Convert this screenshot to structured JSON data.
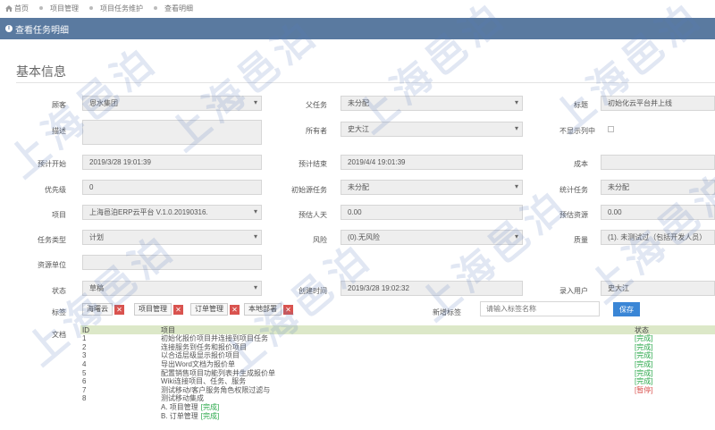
{
  "breadcrumb": [
    "首页",
    "项目管理",
    "项目任务维护",
    "查看明细"
  ],
  "panel_title": "查看任务明细",
  "section_title": "基本信息",
  "fields": {
    "customer": {
      "label": "顾客",
      "value": "恩水集团"
    },
    "parent_task": {
      "label": "父任务",
      "value": "未分配"
    },
    "title": {
      "label": "标题",
      "value": "初始化云平台并上线"
    },
    "description": {
      "label": "描述",
      "value": ""
    },
    "owner": {
      "label": "所有者",
      "value": "史大江"
    },
    "hide_in_list": {
      "label": "不显示列中"
    },
    "plan_start": {
      "label": "预计开始",
      "value": "2019/3/28 19:01:39"
    },
    "plan_end": {
      "label": "预计结束",
      "value": "2019/4/4 19:01:39"
    },
    "cost": {
      "label": "成本",
      "value": ""
    },
    "priority": {
      "label": "优先级",
      "value": "0"
    },
    "initial_source_task": {
      "label": "初始源任务",
      "value": "未分配"
    },
    "stat_task": {
      "label": "统计任务",
      "value": "未分配"
    },
    "project": {
      "label": "项目",
      "value": "上海邑泊ERP云平台 V.1.0.20190316."
    },
    "estimate_days": {
      "label": "预估人天",
      "value": "0.00"
    },
    "estimate_resource": {
      "label": "预估资源",
      "value": "0.00"
    },
    "task_type": {
      "label": "任务类型",
      "value": "计划"
    },
    "risk": {
      "label": "风险",
      "value": "(0).无风险"
    },
    "quality": {
      "label": "质量",
      "value": "(1). 未测试过（包括开发人员）"
    },
    "resource_unit": {
      "label": "资源单位",
      "value": ""
    },
    "status": {
      "label": "状态",
      "value": "草稿"
    },
    "created_time": {
      "label": "创建时间",
      "value": "2019/3/28 19:02:32"
    },
    "entry_user": {
      "label": "录入用户",
      "value": "史大江"
    },
    "tags": {
      "label": "标签",
      "items": [
        "海曙云",
        "项目管理",
        "订单管理",
        "本地部署"
      ]
    },
    "new_tag": {
      "label": "新增标签",
      "placeholder": "请输入标签名称",
      "save_label": "保存"
    },
    "docs": {
      "label": "文档"
    }
  },
  "doc_table": {
    "headers": [
      "ID",
      "项目",
      "状态"
    ],
    "rows": [
      {
        "id": "1",
        "item": "初始化报价项目并连接到项目任务",
        "status": "[完成]",
        "kind": "done"
      },
      {
        "id": "2",
        "item": "连接服务到任务和报价项目",
        "status": "[完成]",
        "kind": "done"
      },
      {
        "id": "3",
        "item": "以合适层级显示报价项目",
        "status": "[完成]",
        "kind": "done"
      },
      {
        "id": "4",
        "item": "导出Word文档为报价单",
        "status": "[完成]",
        "kind": "done"
      },
      {
        "id": "5",
        "item": "配置销售项目功能列表并生成报价单",
        "status": "[完成]",
        "kind": "done"
      },
      {
        "id": "6",
        "item": "Wiki连接项目、任务、服务",
        "status": "[完成]",
        "kind": "done"
      },
      {
        "id": "7",
        "item": "测试移动/客户服务角色权限过滤与",
        "status": "[暂停]",
        "kind": "pause"
      },
      {
        "id": "8",
        "item": "测试移动集成",
        "status": "",
        "kind": ""
      }
    ],
    "subitems": [
      {
        "text": "A. 项目管理",
        "status": "[完成]"
      },
      {
        "text": "B. 订单管理",
        "status": "[完成]"
      }
    ]
  },
  "watermark": "上海邑泊",
  "colors": {
    "title_bar": "#5a7aa0",
    "table_header": "#dce8c8",
    "done": "#2aa84a",
    "pause": "#d9534f",
    "save_button": "#3a86d6"
  }
}
